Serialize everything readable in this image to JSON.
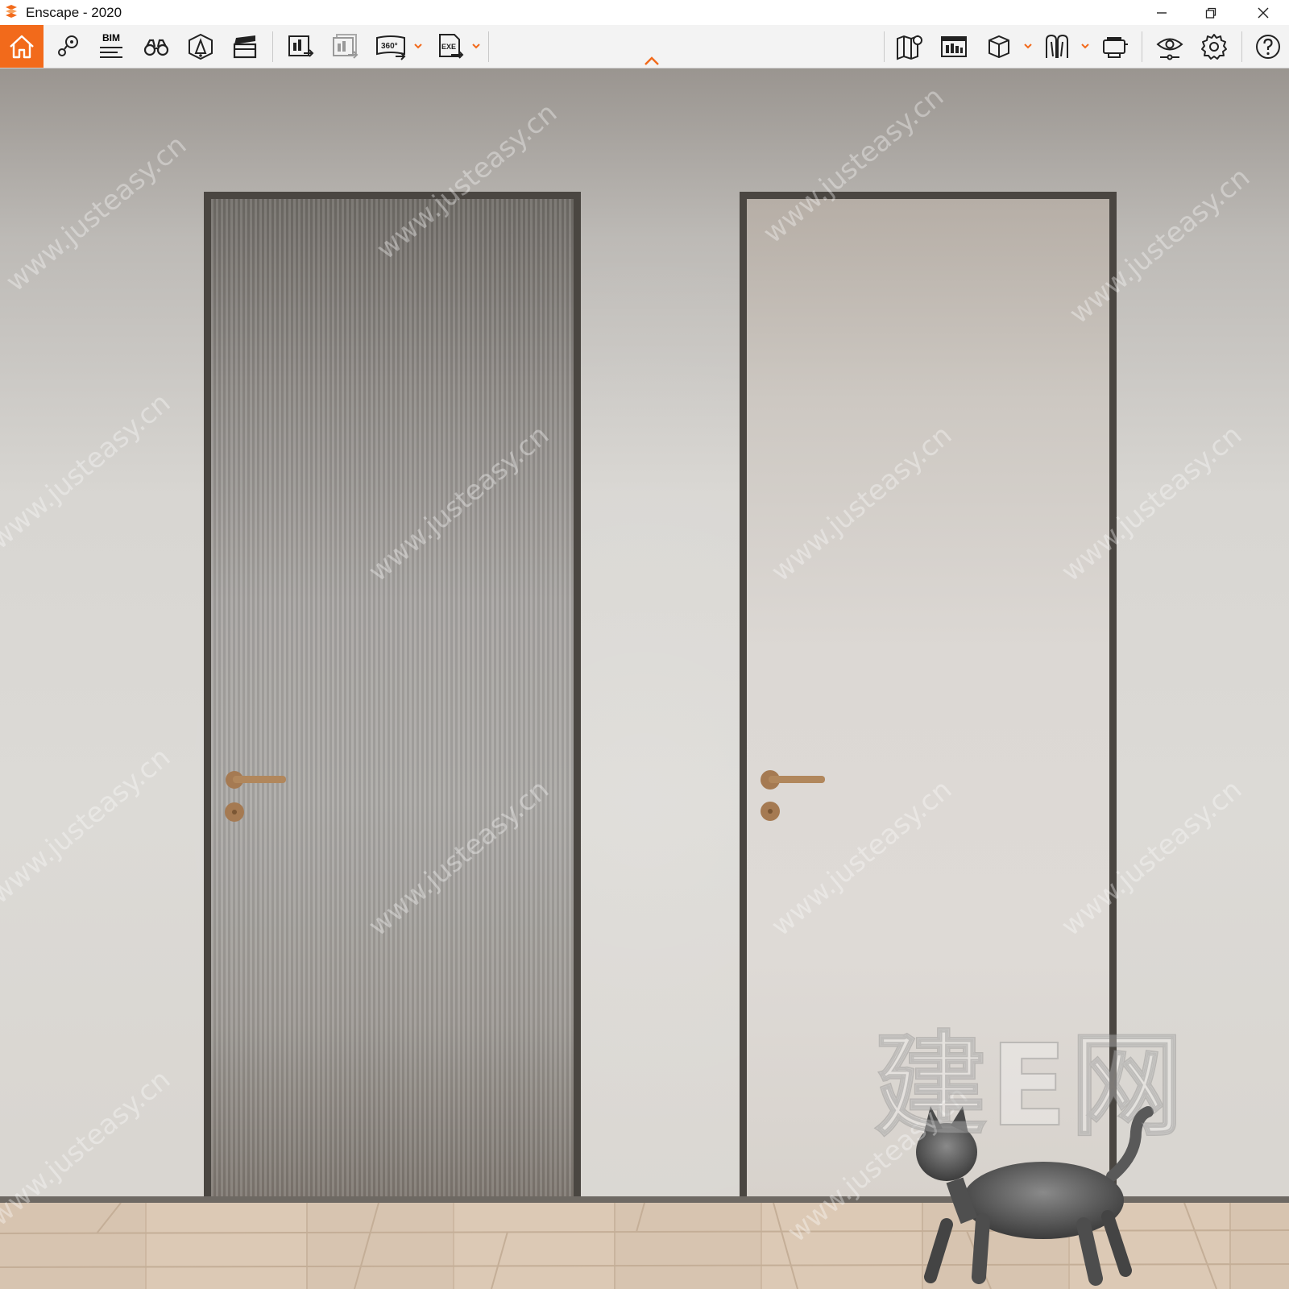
{
  "window": {
    "title": "Enscape - 2020",
    "controls": {
      "minimize": "minimize",
      "maximize": "restore",
      "close": "close"
    }
  },
  "toolbar": {
    "accent_color": "#f26a1b",
    "left_tools": [
      {
        "icon": "home-icon"
      },
      {
        "icon": "map-pin-icon"
      },
      {
        "icon": "bim-icon",
        "label": "BIM"
      },
      {
        "icon": "binoculars-icon"
      },
      {
        "icon": "lighting-cone-icon"
      },
      {
        "icon": "clapperboard-icon"
      }
    ],
    "export_tools": [
      {
        "icon": "screenshot-export-icon"
      },
      {
        "icon": "batch-export-icon"
      },
      {
        "icon": "panorama-export-icon",
        "label": "360°"
      },
      {
        "icon": "exe-export-icon",
        "label": "EXE"
      }
    ],
    "right_tools": [
      {
        "icon": "map-icon"
      },
      {
        "icon": "asset-library-icon"
      },
      {
        "icon": "cube-view-icon"
      },
      {
        "icon": "walk-mode-icon"
      },
      {
        "icon": "vr-headset-icon"
      },
      {
        "icon": "visual-settings-icon"
      },
      {
        "icon": "gear-icon"
      },
      {
        "icon": "help-icon"
      }
    ]
  },
  "scene": {
    "watermark_text": "www.justeasy.cn",
    "watermark_brand": "建E网",
    "colors": {
      "wall": "#dcdad6",
      "frame": "#4a4641",
      "handle": "#a57a52",
      "floor": "#d7c4b0"
    }
  }
}
